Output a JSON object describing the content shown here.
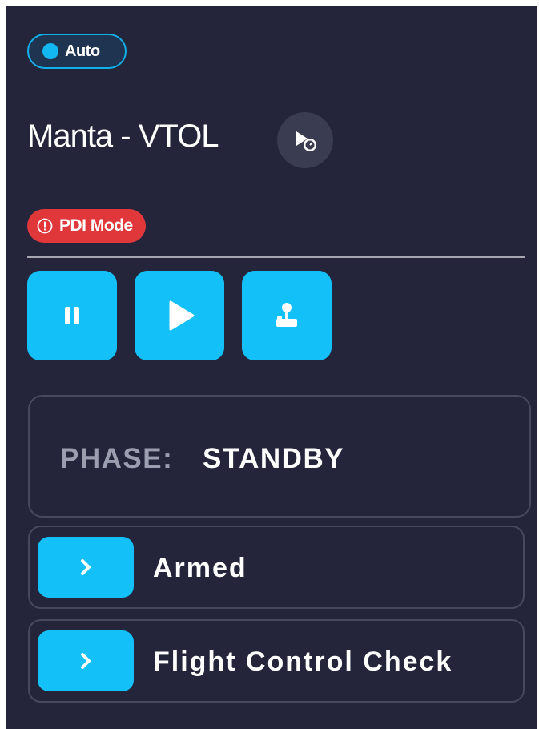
{
  "mode": {
    "label": "Auto"
  },
  "vehicle": {
    "name": "Manta - VTOL",
    "speed_icon": "play-gauge-icon"
  },
  "alert": {
    "icon": "exclamation-circle-icon",
    "label": "PDI Mode"
  },
  "controls": [
    {
      "name": "pause",
      "icon": "pause-icon"
    },
    {
      "name": "play",
      "icon": "play-icon"
    },
    {
      "name": "joystick",
      "icon": "joystick-icon"
    }
  ],
  "phase": {
    "label": "PHASE:",
    "value": "STANDBY"
  },
  "steps": [
    {
      "label": "Armed",
      "icon": "chevron-right-icon"
    },
    {
      "label": "Flight Control Check",
      "icon": "chevron-right-icon"
    }
  ],
  "colors": {
    "panel_bg": "#24253a",
    "accent": "#14c0f8",
    "alert": "#e0383a",
    "muted_text": "#9b9eae"
  }
}
